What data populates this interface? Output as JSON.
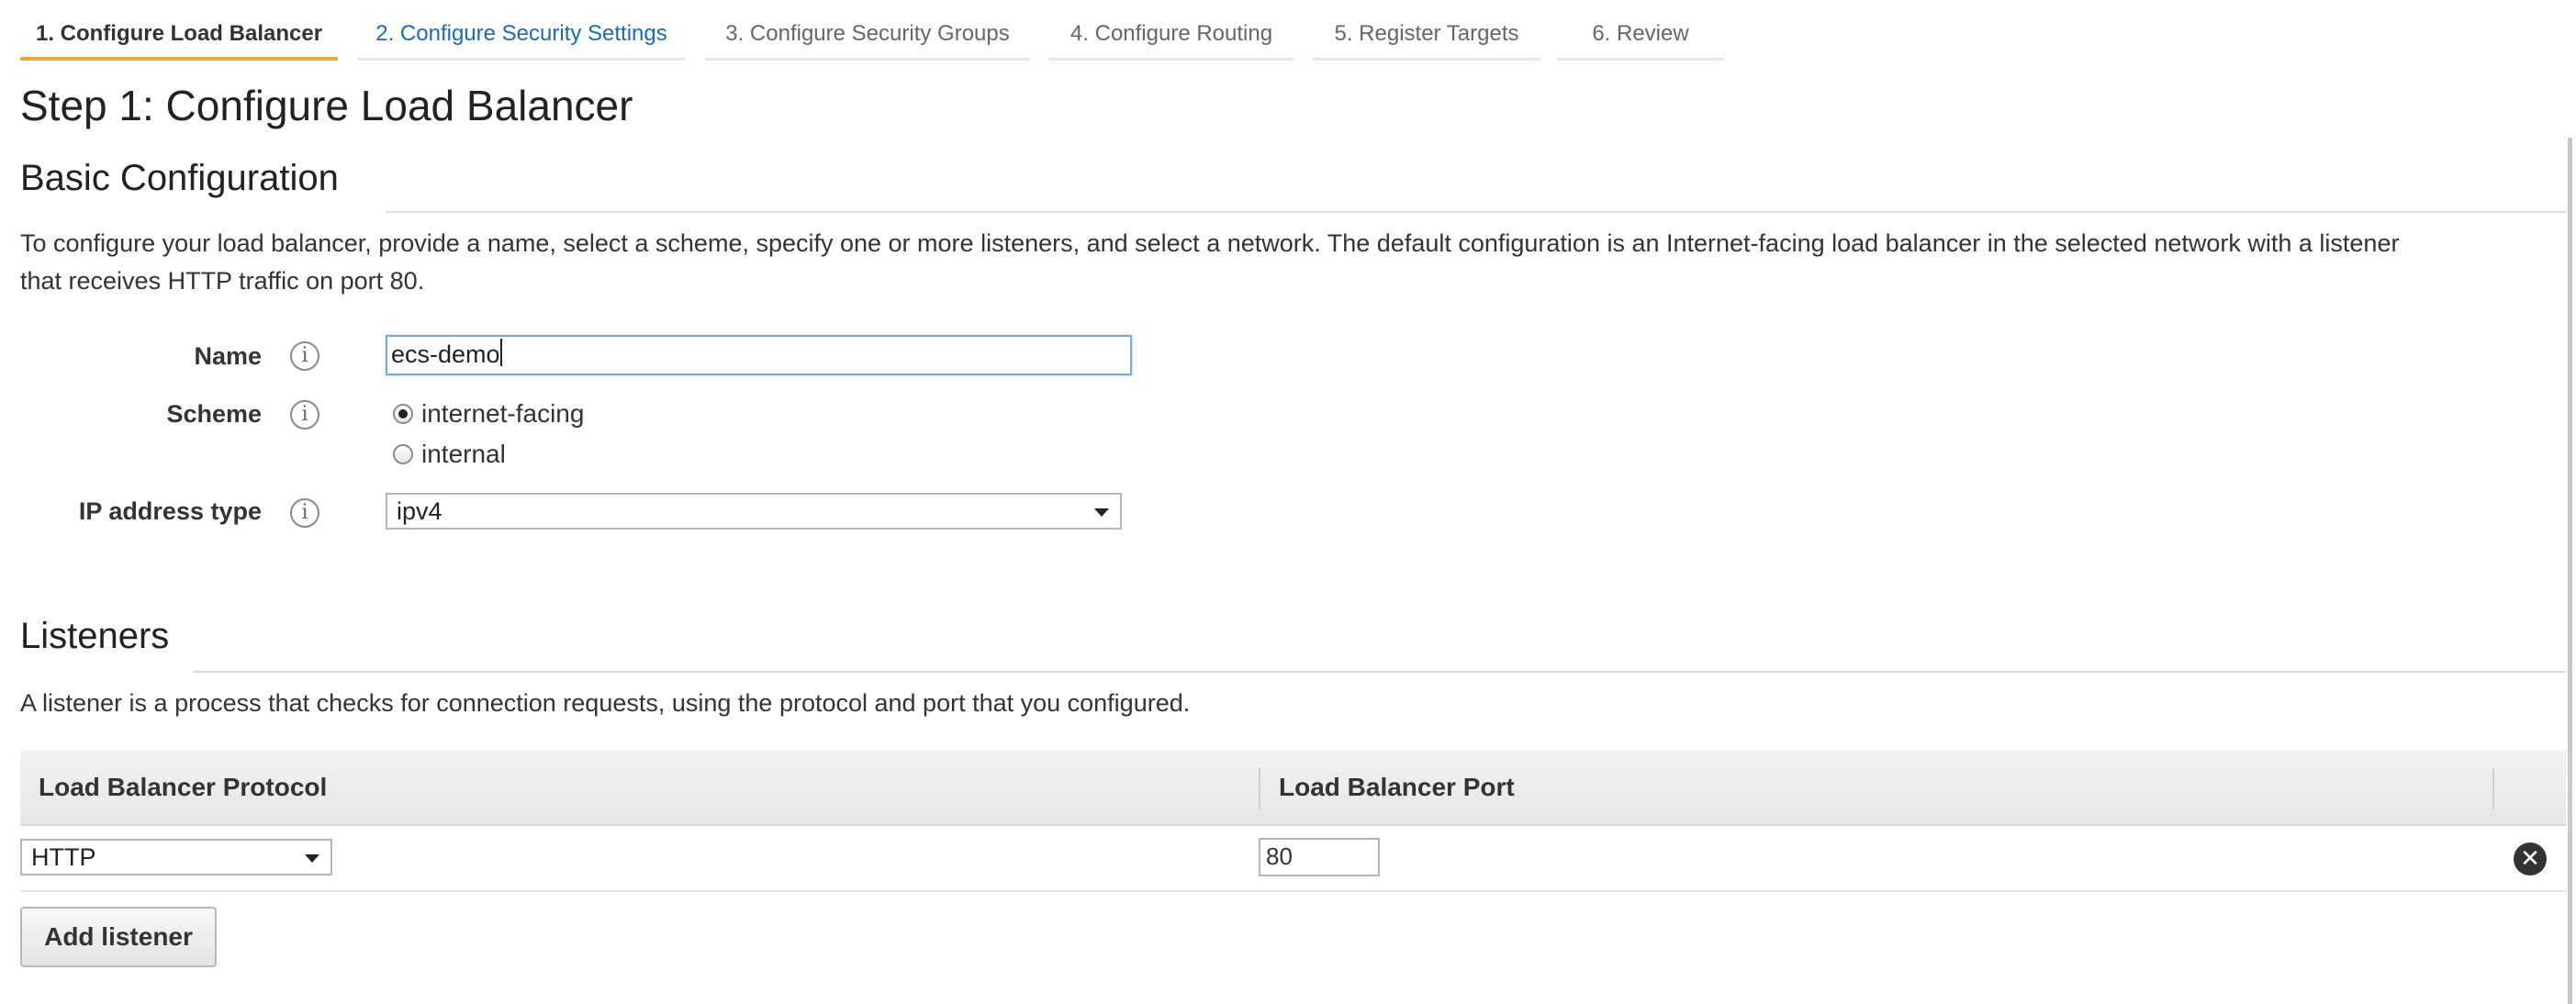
{
  "wizard": {
    "tabs": [
      {
        "label": "1. Configure Load Balancer"
      },
      {
        "label": "2. Configure Security Settings"
      },
      {
        "label": "3. Configure Security Groups"
      },
      {
        "label": "4. Configure Routing"
      },
      {
        "label": "5. Register Targets"
      },
      {
        "label": "6. Review"
      }
    ],
    "active_tab_color": "#f0a13c",
    "link_tab_color": "#1a6bb5"
  },
  "page_title": "Step 1: Configure Load Balancer",
  "basic": {
    "heading": "Basic Configuration",
    "description_line1": "To configure your load balancer, provide a name, select a scheme, specify one or more listeners, and select a network. The default configuration is an Internet-facing load balancer in the selected network with a listener",
    "description_line2": "that receives HTTP traffic on port 80.",
    "name": {
      "label": "Name",
      "value": "ecs-demo"
    },
    "scheme": {
      "label": "Scheme",
      "options": [
        {
          "label": "internet-facing",
          "selected": true
        },
        {
          "label": "internal",
          "selected": false
        }
      ]
    },
    "ip_type": {
      "label": "IP address type",
      "value": "ipv4"
    },
    "info_icon_glyph": "i"
  },
  "listeners": {
    "heading": "Listeners",
    "description": "A listener is a process that checks for connection requests, using the protocol and port that you configured.",
    "columns": [
      "Load Balancer Protocol",
      "Load Balancer Port"
    ],
    "rows": [
      {
        "protocol": "HTTP",
        "port": "80"
      }
    ],
    "add_button": "Add listener",
    "remove_icon_glyph": "✕"
  }
}
